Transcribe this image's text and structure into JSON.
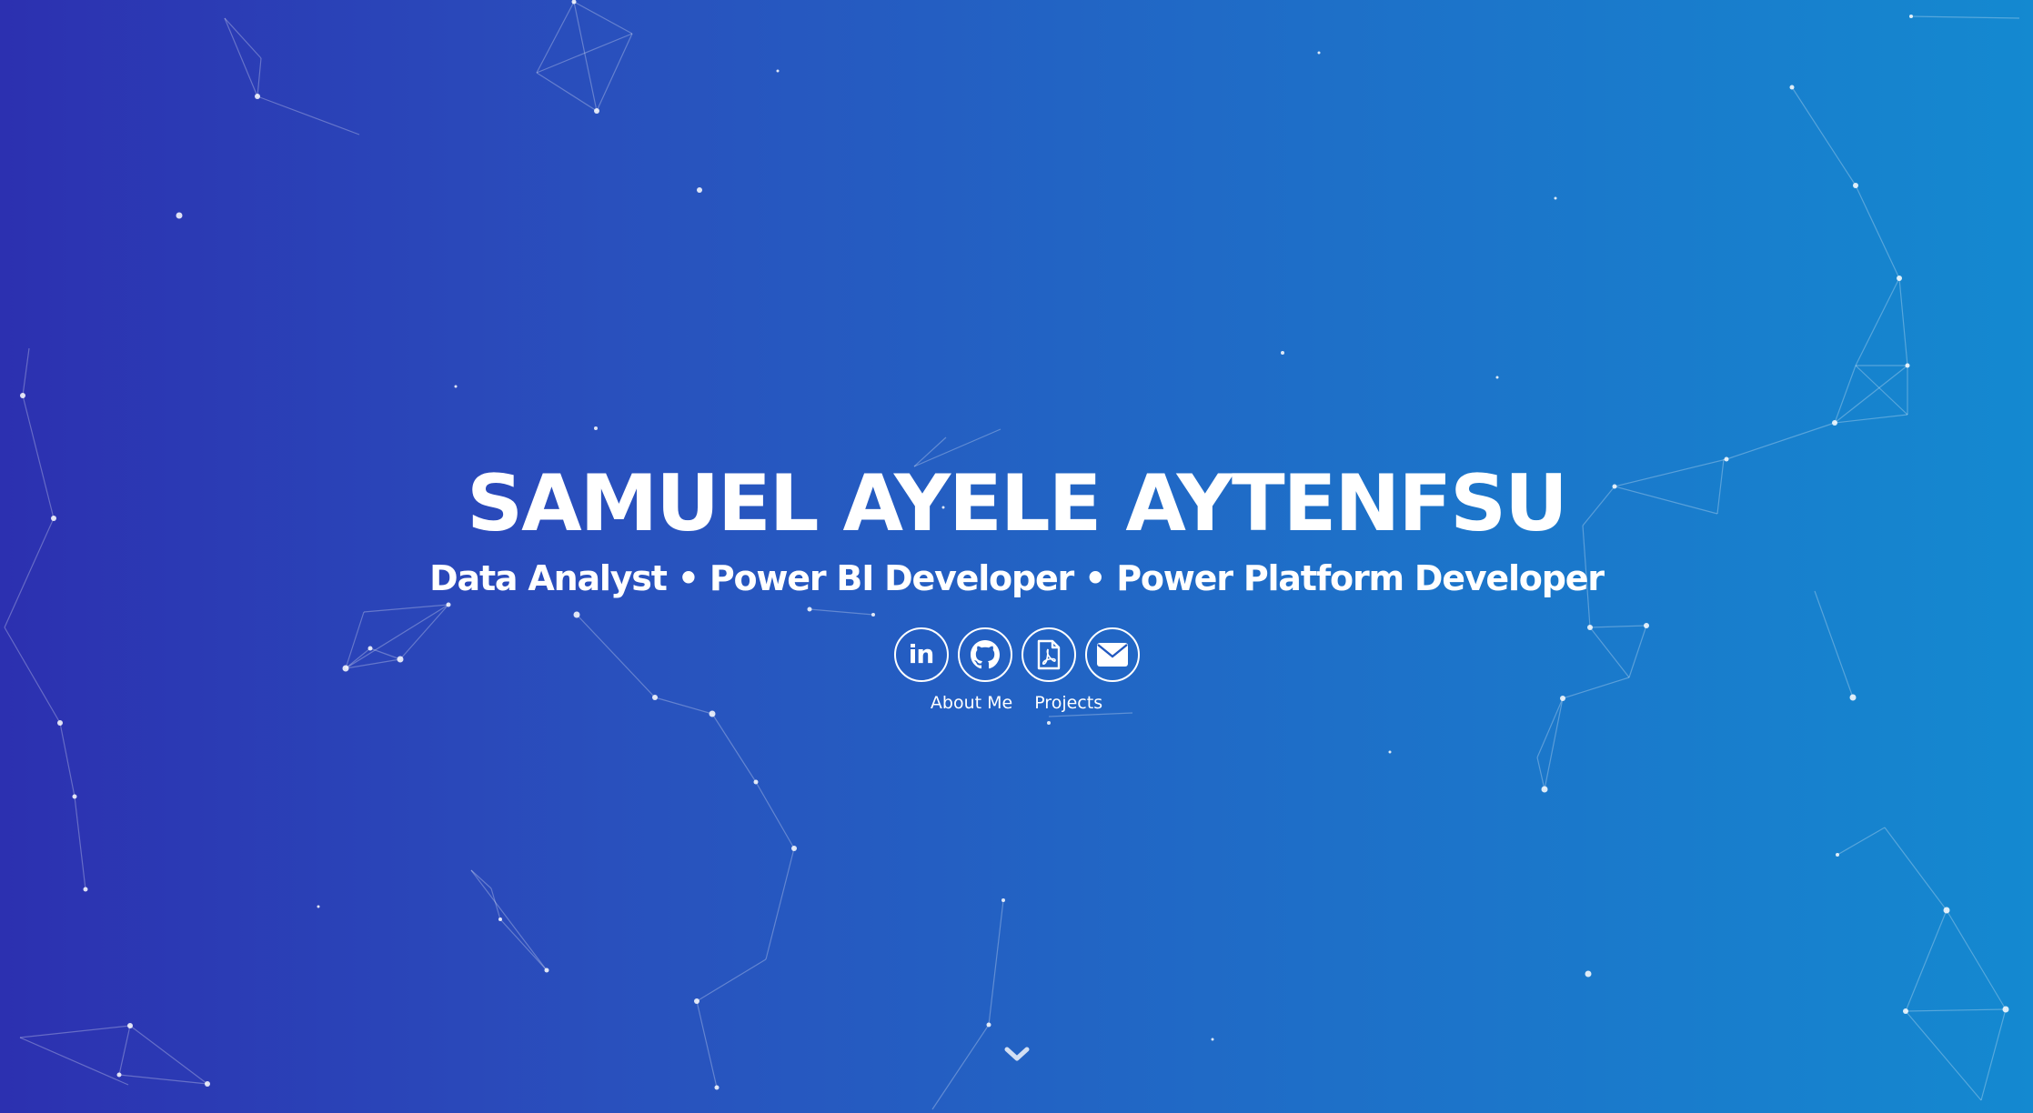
{
  "hero": {
    "name": "SAMUEL AYELE AYTENFSU",
    "tagline": "Data Analyst • Power BI Developer • Power Platform Developer"
  },
  "social": [
    {
      "icon": "linkedin-icon",
      "label": "in"
    },
    {
      "icon": "github-icon"
    },
    {
      "icon": "pdf-resume-icon"
    },
    {
      "icon": "email-icon"
    }
  ],
  "nav": {
    "about_label": "About Me",
    "projects_label": "Projects"
  },
  "scroll": {
    "icon": "chevron-down-icon"
  },
  "colors": {
    "gradient_start": "#2c30b0",
    "gradient_end": "#1489d0",
    "text": "#ffffff"
  }
}
